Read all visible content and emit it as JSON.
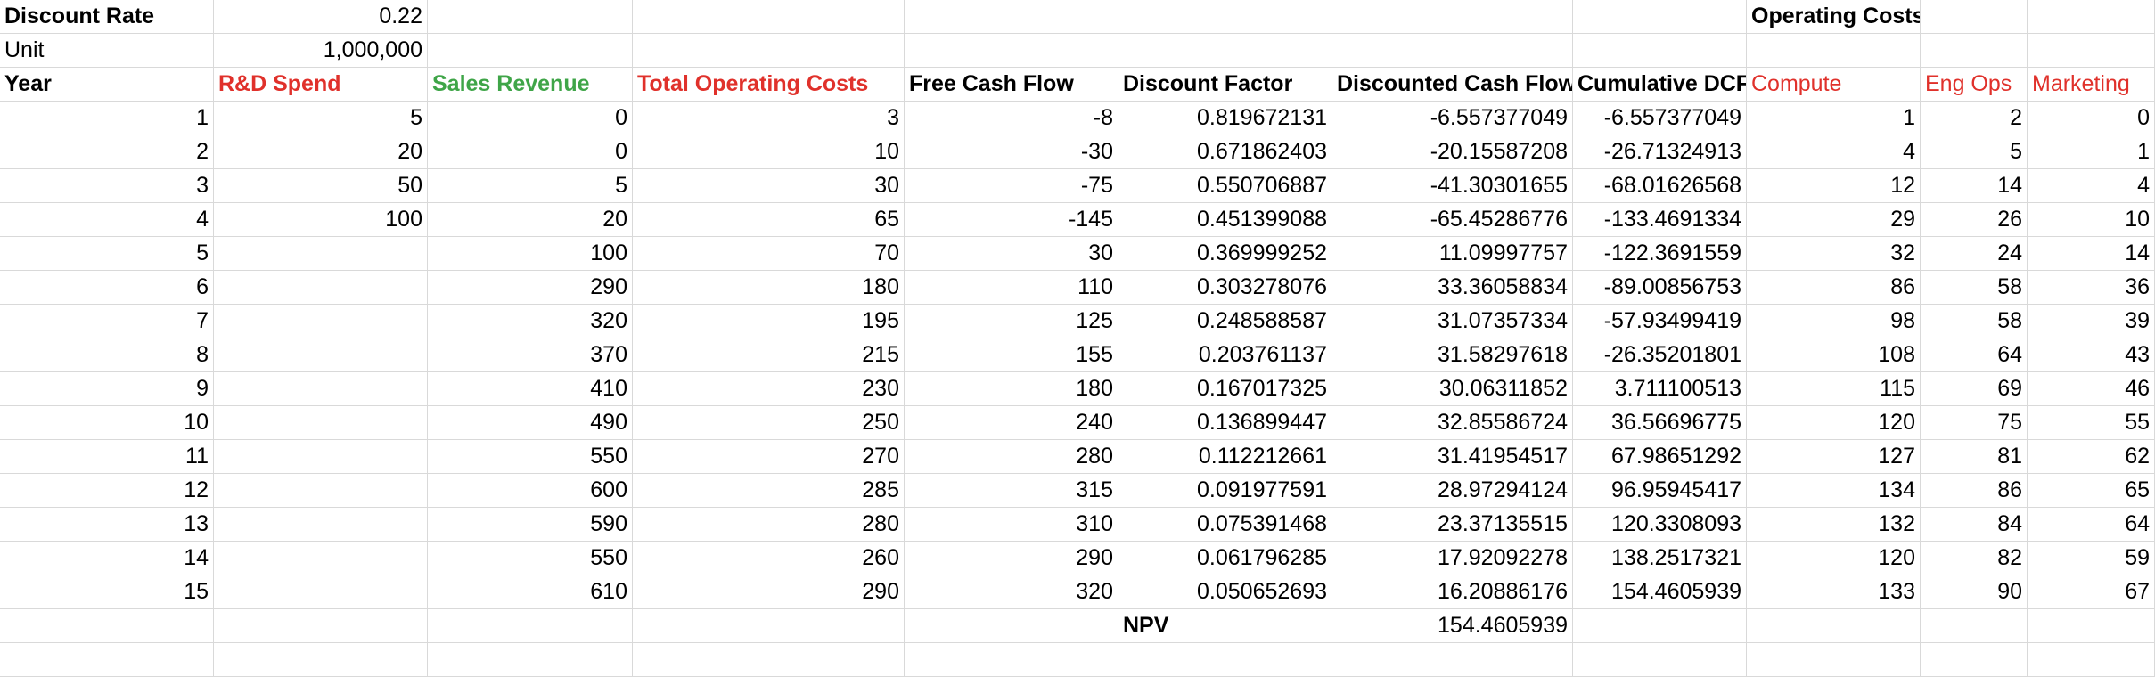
{
  "colors": {
    "cost_header": "#e0312b",
    "revenue_header": "#3fa548",
    "gridline": "#d9d9d9"
  },
  "parameters": {
    "discount_rate_label": "Discount Rate",
    "discount_rate_value": "0.22",
    "unit_label": "Unit",
    "unit_value": "1,000,000"
  },
  "operating_costs_title": "Operating Costs",
  "headers": {
    "year": "Year",
    "rd_spend": "R&D Spend",
    "sales_revenue": "Sales Revenue",
    "total_operating_costs": "Total Operating Costs",
    "free_cash_flow": "Free Cash Flow",
    "discount_factor": "Discount Factor",
    "discounted_cash_flow": "Discounted Cash Flow",
    "cumulative_dcf": "Cumulative DCF",
    "compute": "Compute",
    "eng_ops": "Eng Ops",
    "marketing": "Marketing"
  },
  "rows": [
    [
      "1",
      "5",
      "0",
      "3",
      "-8",
      "0.819672131",
      "-6.557377049",
      "-6.557377049",
      "1",
      "2",
      "0"
    ],
    [
      "2",
      "20",
      "0",
      "10",
      "-30",
      "0.671862403",
      "-20.15587208",
      "-26.71324913",
      "4",
      "5",
      "1"
    ],
    [
      "3",
      "50",
      "5",
      "30",
      "-75",
      "0.550706887",
      "-41.30301655",
      "-68.01626568",
      "12",
      "14",
      "4"
    ],
    [
      "4",
      "100",
      "20",
      "65",
      "-145",
      "0.451399088",
      "-65.45286776",
      "-133.4691334",
      "29",
      "26",
      "10"
    ],
    [
      "5",
      "",
      "100",
      "70",
      "30",
      "0.369999252",
      "11.09997757",
      "-122.3691559",
      "32",
      "24",
      "14"
    ],
    [
      "6",
      "",
      "290",
      "180",
      "110",
      "0.303278076",
      "33.36058834",
      "-89.00856753",
      "86",
      "58",
      "36"
    ],
    [
      "7",
      "",
      "320",
      "195",
      "125",
      "0.248588587",
      "31.07357334",
      "-57.93499419",
      "98",
      "58",
      "39"
    ],
    [
      "8",
      "",
      "370",
      "215",
      "155",
      "0.203761137",
      "31.58297618",
      "-26.35201801",
      "108",
      "64",
      "43"
    ],
    [
      "9",
      "",
      "410",
      "230",
      "180",
      "0.167017325",
      "30.06311852",
      "3.711100513",
      "115",
      "69",
      "46"
    ],
    [
      "10",
      "",
      "490",
      "250",
      "240",
      "0.136899447",
      "32.85586724",
      "36.56696775",
      "120",
      "75",
      "55"
    ],
    [
      "11",
      "",
      "550",
      "270",
      "280",
      "0.112212661",
      "31.41954517",
      "67.98651292",
      "127",
      "81",
      "62"
    ],
    [
      "12",
      "",
      "600",
      "285",
      "315",
      "0.091977591",
      "28.97294124",
      "96.95945417",
      "134",
      "86",
      "65"
    ],
    [
      "13",
      "",
      "590",
      "280",
      "310",
      "0.075391468",
      "23.37135515",
      "120.3308093",
      "132",
      "84",
      "64"
    ],
    [
      "14",
      "",
      "550",
      "260",
      "290",
      "0.061796285",
      "17.92092278",
      "138.2517321",
      "120",
      "82",
      "59"
    ],
    [
      "15",
      "",
      "610",
      "290",
      "320",
      "0.050652693",
      "16.20886176",
      "154.4605939",
      "133",
      "90",
      "67"
    ]
  ],
  "npv": {
    "label": "NPV",
    "value": "154.4605939"
  }
}
